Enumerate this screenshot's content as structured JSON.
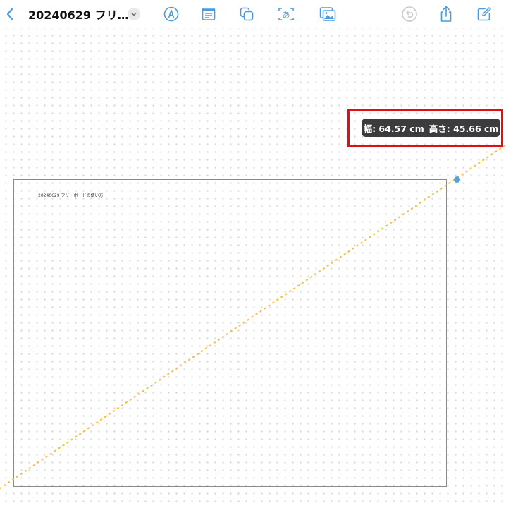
{
  "toolbar": {
    "title": "20240629 フリ…",
    "icons": [
      "back-chevron-icon",
      "title-menu-chevron-icon",
      "pen-tool-icon",
      "text-box-icon",
      "shapes-icon",
      "text-recognition-icon",
      "media-icon",
      "undo-icon",
      "share-icon",
      "new-board-icon"
    ]
  },
  "board": {
    "label": "20240629 フリーボードの使い方"
  },
  "size_indicator": {
    "width_text": "幅: 64.57 cm",
    "height_text": "高さ: 45.66 cm"
  },
  "colors": {
    "accent": "#4a9be0",
    "guide_line": "#f4c04a",
    "highlight": "#e00f15",
    "pill": "#3c3c3e"
  }
}
